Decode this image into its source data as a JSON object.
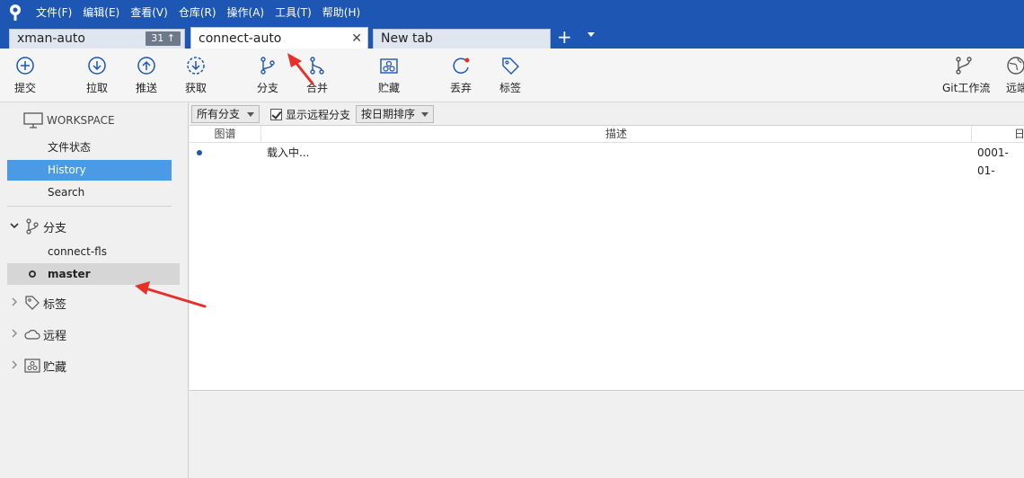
{
  "menu": {
    "items": [
      "文件(F)",
      "编辑(E)",
      "查看(V)",
      "仓库(R)",
      "操作(A)",
      "工具(T)",
      "帮助(H)"
    ]
  },
  "tabs": [
    {
      "label": "xman-auto",
      "badge": "31 ↑",
      "active": false
    },
    {
      "label": "connect-auto",
      "close": "✕",
      "active": true
    },
    {
      "label": "New tab",
      "active": false
    }
  ],
  "tabbar": {
    "new_tab": "+"
  },
  "toolbar": {
    "commit": "提交",
    "pull": "拉取",
    "push": "推送",
    "fetch": "获取",
    "branch": "分支",
    "merge": "合并",
    "stash": "贮藏",
    "discard": "丢弃",
    "tag": "标签",
    "gitflow": "Git工作流",
    "remote": "远端"
  },
  "sidebar": {
    "workspace": "WORKSPACE",
    "workspace_items": [
      "文件状态",
      "History",
      "Search"
    ],
    "branches_label": "分支",
    "branches": [
      "connect-fls",
      "master"
    ],
    "tags_label": "标签",
    "remotes_label": "远程",
    "stashes_label": "贮藏"
  },
  "filter": {
    "branch_filter": "所有分支",
    "show_remote": "显示远程分支",
    "sort": "按日期排序"
  },
  "columns": {
    "graph": "图谱",
    "description": "描述",
    "date": "日"
  },
  "commits": [
    {
      "description": "载入中...",
      "date": "0001-01-"
    }
  ],
  "colors": {
    "accent": "#1d56b3",
    "selection": "#4a9ae6",
    "annotation": "#e8302a"
  }
}
